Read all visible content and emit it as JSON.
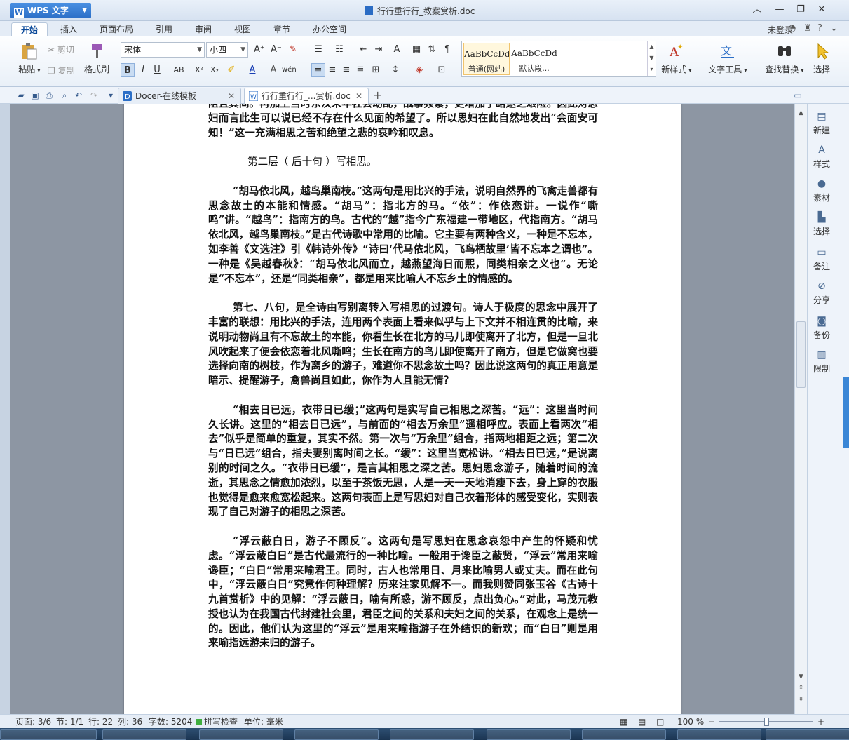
{
  "app": {
    "name": "WPS 文字",
    "doc_title": "行行重行行_教案赏析.doc"
  },
  "menu": {
    "tabs": [
      "开始",
      "插入",
      "页面布局",
      "引用",
      "审阅",
      "视图",
      "章节",
      "办公空间"
    ],
    "login": "未登录"
  },
  "ribbon": {
    "paste": "粘贴",
    "cut": "剪切",
    "copy": "复制",
    "format_painter": "格式刷",
    "font_name": "宋体",
    "font_size": "小四",
    "styles": [
      {
        "sample": "AaBbCcDd",
        "name": "普通(网站)"
      },
      {
        "sample": "AaBbCcDd",
        "name": "默认段..."
      }
    ],
    "new_style": "新样式",
    "text_tools": "文字工具",
    "find_replace": "查找替换",
    "select": "选择"
  },
  "tabs": {
    "tab1": "Docer-在线模板",
    "tab2": "行行重行行_...赏析.doc"
  },
  "right_panel": [
    "新建",
    "样式",
    "素材",
    "选择",
    "备注",
    "分享",
    "备份",
    "限制"
  ],
  "document": {
    "p0": "阻且其间。再加上当时东汉末年社会动乱，战事频繁，更增加了路途之艰险。因此对思妇而言此生可以说已经不存在什么见面的希望了。所以思妇在此自然地发出“会面安可知！”这一充满相思之苦和绝望之悲的哀吟和叹息。",
    "h1": "第二层（ 后十句 ）写相思。",
    "p1": "“胡马依北风，越鸟巢南枝。”这两句是用比兴的手法，说明自然界的飞禽走兽都有思念故土的本能和情感。“胡马”：指北方的马。“依”：作依恋讲。一说作“嘶鸣”讲。“越鸟”：指南方的鸟。古代的“越”指今广东福建一带地区，代指南方。“胡马依北风，越鸟巢南枝。”是古代诗歌中常用的比喻。它主要有两种含义，一种是不忘本，如李善《文选注》引《韩诗外传》“诗曰‘代马依北风，飞鸟栖故里’皆不忘本之谓也”。一种是《吴越春秋》：“胡马依北风而立，越燕望海日而熙，同类相亲之义也”。无论是“不忘本”，还是“同类相亲”，都是用来比喻人不忘乡土的情感的。",
    "p2": "第七、八句，是全诗由写别离转入写相思的过渡句。诗人于极度的思念中展开了丰富的联想：用比兴的手法，连用两个表面上看来似乎与上下文并不相连贯的比喻，来说明动物尚且有不忘故土的本能，你看生长在北方的马儿即使离开了北方，但是一旦北风吹起来了便会依恋着北风嘶鸣；生长在南方的鸟儿即使离开了南方，但是它做窝也要选择向南的树枝，作为离乡的游子，难道你不思念故土吗？因此说这两句的真正用意是暗示、提醒游子，禽兽尚且如此，你作为人且能无情？",
    "p3": "“相去日已远，衣带日已缓；”这两句是实写自己相思之深苦。“远”：这里当时间久长讲。这里的“相去日已远”，与前面的“相去万余里”遥相呼应。表面上看两次“相去”似乎是简单的重复，其实不然。第一次与“万余里”组合，指两地相距之远；第二次与“日已远”组合，指夫妻别离时间之长。“缓”：这里当宽松讲。“相去日已远，”是说离别的时间之久。“衣带日已缓”，是言其相思之深之苦。思妇思念游子，随着时间的流逝，其思念之情愈加浓烈，以至于茶饭无思，人是一天一天地消瘦下去，身上穿的衣服也觉得是愈来愈宽松起来。这两句表面上是写思妇对自己衣着形体的感受变化，实则表现了自己对游子的相思之深苦。",
    "p4": "“浮云蔽白日，游子不顾反”。这两句是写思妇在思念哀怨中产生的怀疑和忧虑。“浮云蔽白日”是古代最流行的一种比喻。一般用于谗臣之蔽贤，“浮云”常用来喻谗臣；“白日”常用来喻君王。同时，古人也常用日、月来比喻男人或丈夫。而在此句中，“浮云蔽白日”究竟作何种理解？历来注家见解不一。而我则赞同张玉谷《古诗十九首赏析》中的见解：“浮云蔽日，喻有所惑，游不顾反，点出负心。”对此，马茂元教授也认为在我国古代封建社会里，君臣之间的关系和夫妇之间的关系，在观念上是统一的。因此，他们认为这里的“浮云”是用来喻指游子在外结识的新欢；而“白日”则是用来喻指远游未归的游子。"
  },
  "status": {
    "page": "页面: 3/6",
    "section": "节: 1/1",
    "row": "行: 22",
    "col": "列: 36",
    "words": "字数: 5204",
    "spell": "拼写检查",
    "unit": "单位: 毫米",
    "zoom": "100 %"
  },
  "colors": {
    "accent": "#2c6fc7",
    "page": "#ffffff",
    "workspace": "#8d96a3"
  }
}
